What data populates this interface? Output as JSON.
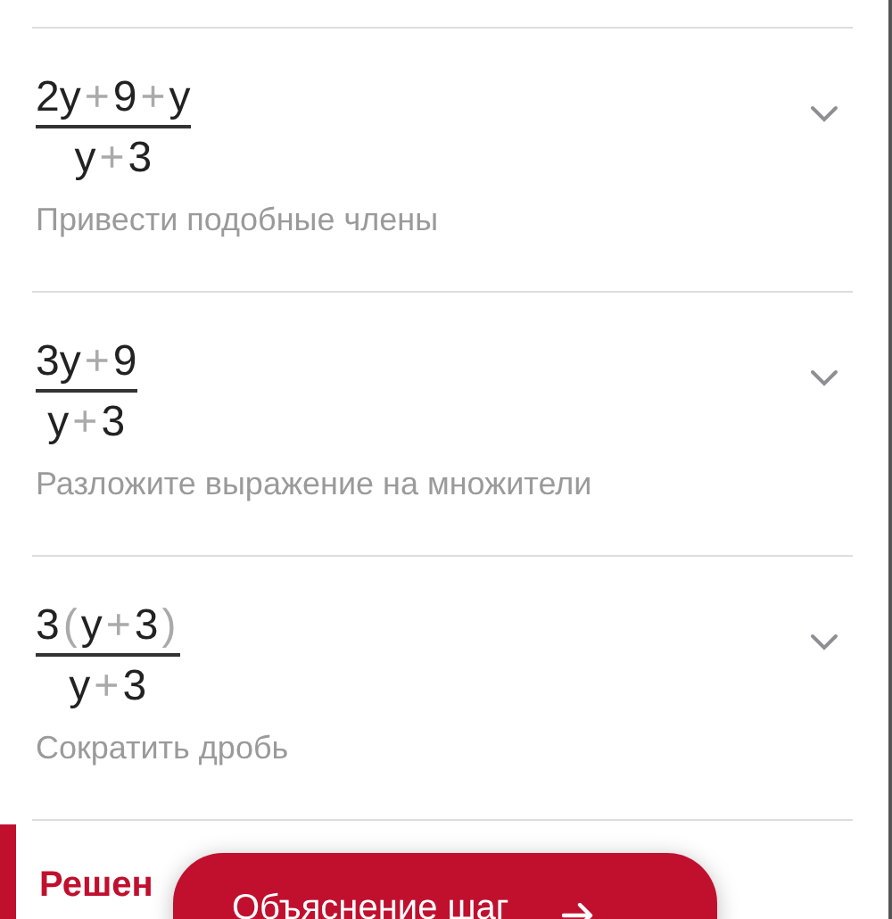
{
  "steps": [
    {
      "numerator": [
        {
          "kind": "term",
          "text": "2y"
        },
        {
          "kind": "op",
          "text": "+"
        },
        {
          "kind": "term",
          "text": "9"
        },
        {
          "kind": "op",
          "text": "+"
        },
        {
          "kind": "term",
          "text": "y"
        }
      ],
      "denominator": [
        {
          "kind": "term",
          "text": "y"
        },
        {
          "kind": "op",
          "text": "+"
        },
        {
          "kind": "term",
          "text": "3"
        }
      ],
      "description": "Привести подобные члены",
      "expanded": false
    },
    {
      "numerator": [
        {
          "kind": "term",
          "text": "3y"
        },
        {
          "kind": "op",
          "text": "+"
        },
        {
          "kind": "term",
          "text": "9"
        }
      ],
      "denominator": [
        {
          "kind": "term",
          "text": "y"
        },
        {
          "kind": "op",
          "text": "+"
        },
        {
          "kind": "term",
          "text": "3"
        }
      ],
      "description": "Разложите выражение на множители",
      "expanded": false
    },
    {
      "numerator": [
        {
          "kind": "term",
          "text": "3"
        },
        {
          "kind": "op",
          "text": "("
        },
        {
          "kind": "term",
          "text": "y"
        },
        {
          "kind": "op",
          "text": "+"
        },
        {
          "kind": "term",
          "text": "3"
        },
        {
          "kind": "op",
          "text": ")"
        }
      ],
      "denominator": [
        {
          "kind": "term",
          "text": "y"
        },
        {
          "kind": "op",
          "text": "+"
        },
        {
          "kind": "term",
          "text": "3"
        }
      ],
      "description": "Сократить дробь",
      "expanded": false
    }
  ],
  "section_heading": "Решен",
  "explain_button": "Объяснение шаг"
}
